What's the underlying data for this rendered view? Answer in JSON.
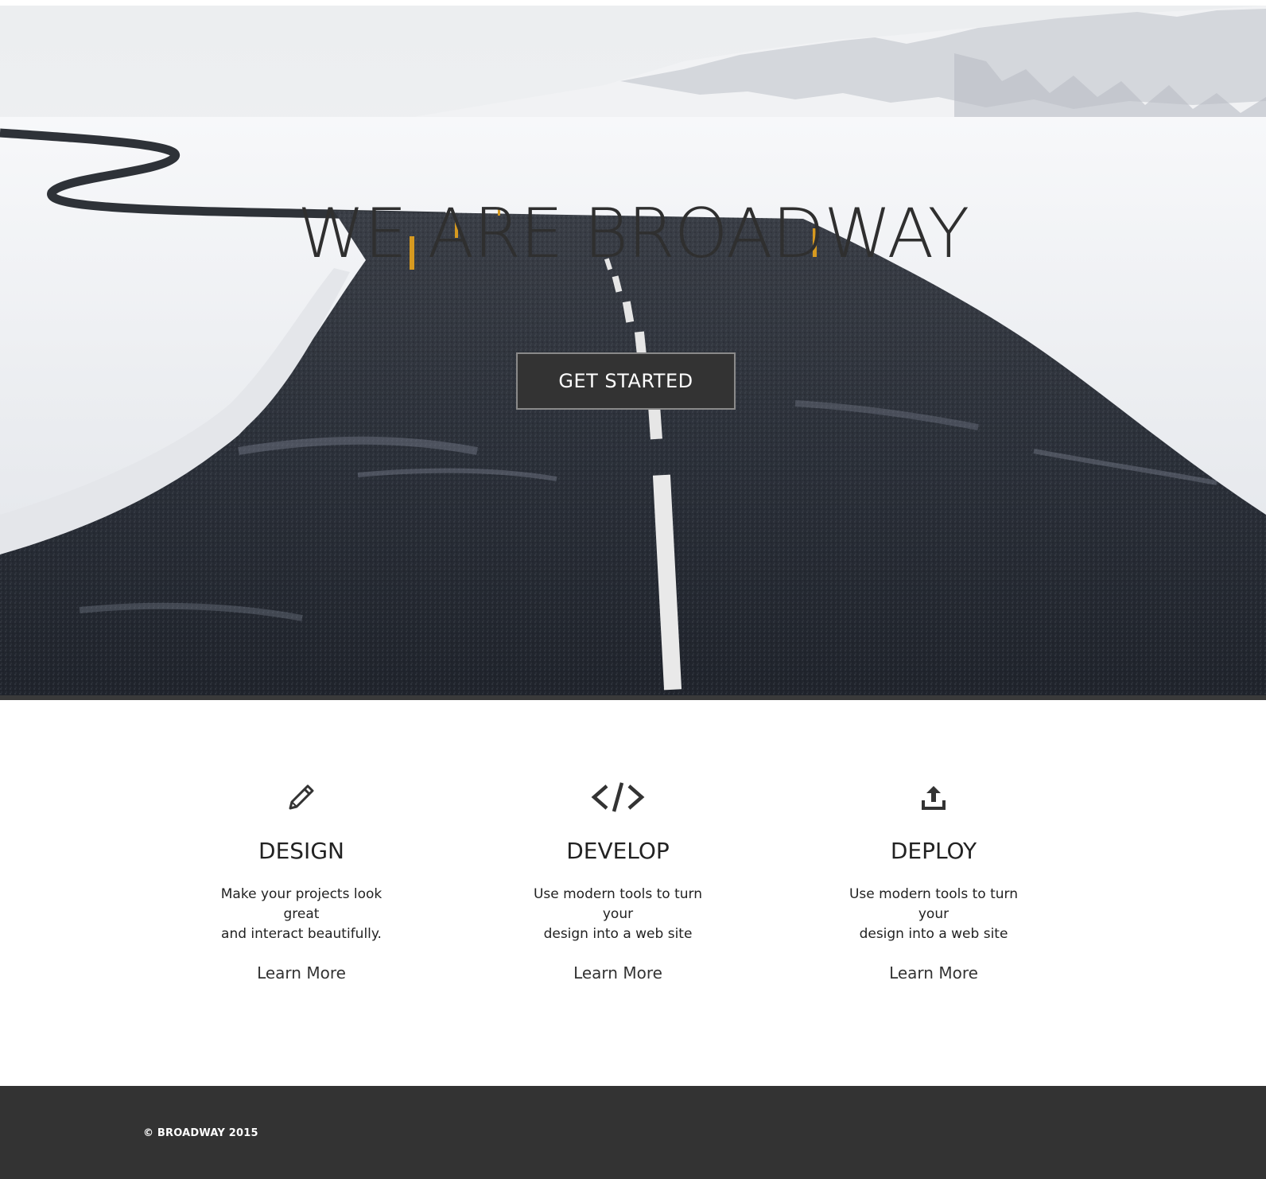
{
  "hero": {
    "title": "WE ARE BROADWAY",
    "button_label": "GET STARTED"
  },
  "features": [
    {
      "icon": "pencil-icon",
      "title": "DESIGN",
      "desc_line1": "Make your projects look great",
      "desc_line2": "and interact beautifully.",
      "link": "Learn More"
    },
    {
      "icon": "code-icon",
      "title": "DEVELOP",
      "desc_line1": "Use modern tools to turn your",
      "desc_line2": "design into a web site",
      "link": "Learn More"
    },
    {
      "icon": "upload-icon",
      "title": "DEPLOY",
      "desc_line1": "Use modern tools to turn your",
      "desc_line2": "design into a web site",
      "link": "Learn More"
    }
  ],
  "footer": {
    "copyright": "© BROADWAY 2015"
  },
  "colors": {
    "dark": "#333333",
    "text": "#222222",
    "background": "#ffffff"
  }
}
